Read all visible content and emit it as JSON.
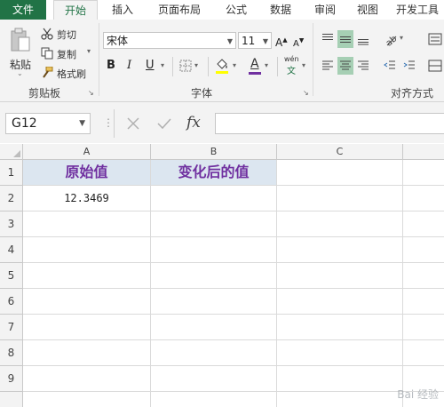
{
  "tabs": [
    "文件",
    "开始",
    "插入",
    "页面布局",
    "公式",
    "数据",
    "审阅",
    "视图",
    "开发工具"
  ],
  "clipboard": {
    "paste": "粘贴",
    "cut": "剪切",
    "copy": "复制",
    "format_painter": "格式刷",
    "group_label": "剪贴板"
  },
  "font": {
    "name": "宋体",
    "size": "11",
    "bold": "B",
    "italic": "I",
    "underline": "U",
    "phonetic_top": "wén",
    "phonetic_bottom": "文",
    "group_label": "字体"
  },
  "alignment": {
    "group_label": "对齐方式"
  },
  "formula_bar": {
    "name_box": "G12",
    "fx": "fx",
    "value": ""
  },
  "columns": [
    "A",
    "B",
    "C"
  ],
  "rows": [
    "1",
    "2",
    "3",
    "4",
    "5",
    "6",
    "7",
    "8",
    "9"
  ],
  "cells": {
    "A1": "原始值",
    "B1": "变化后的值",
    "A2": "12.3469"
  },
  "colors": {
    "accent": "#217346",
    "header_fill": "#dce6f0",
    "header_text": "#7030a0",
    "font_color_bar": "#7030a0",
    "fill_color_bar": "#ffff00"
  },
  "watermark": "Bai 经验"
}
